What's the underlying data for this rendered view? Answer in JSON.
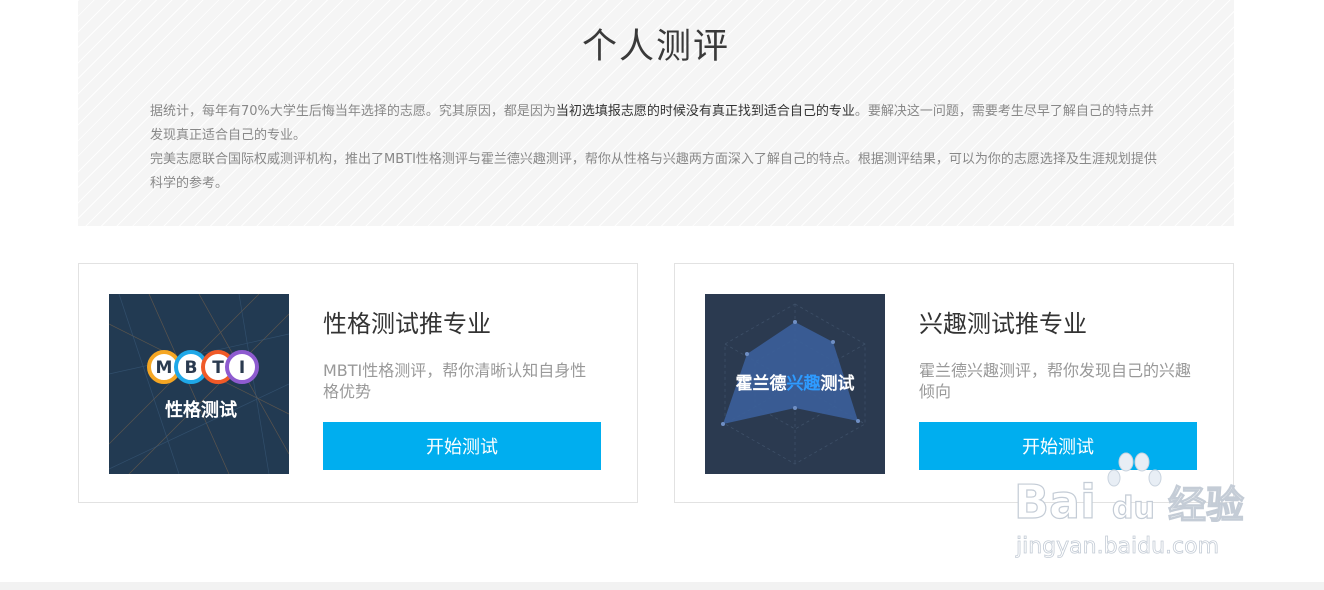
{
  "intro": {
    "title": "个人测评",
    "para1_pre": "据统计，每年有70%大学生后悔当年选择的志愿。究其原因，都是因为",
    "para1_highlight": "当初选填报志愿的时候没有真正找到适合自己的专业",
    "para1_post": "。要解决这一问题，需要考生尽早了解自己的特点并发现真正适合自己的专业。",
    "para2": "完美志愿联合国际权威测评机构，推出了MBTI性格测评与霍兰德兴趣测评，帮你从性格与兴趣两方面深入了解自己的特点。根据测评结果，可以为你的志愿选择及生涯规划提供科学的参考。"
  },
  "cards": [
    {
      "title": "性格测试推专业",
      "description": "MBTI性格测评，帮你清晰认知自身性格优势",
      "button_label": "开始测试",
      "image": {
        "letters": [
          "M",
          "B",
          "T",
          "I"
        ],
        "ring_colors": [
          "#f5a623",
          "#1fa8e8",
          "#f05a28",
          "#8e5bd0"
        ],
        "caption": "性格测试"
      }
    },
    {
      "title": "兴趣测试推专业",
      "description": "霍兰德兴趣测评，帮你发现自己的兴趣倾向",
      "button_label": "开始测试",
      "image": {
        "caption_part1": "霍兰德",
        "caption_part2": "兴趣",
        "caption_part3": "测试",
        "accent_color": "#2e9bff"
      }
    }
  ],
  "watermark": {
    "brand": "Bai",
    "brand2": "du",
    "product": "经验",
    "url": "jingyan.baidu.com"
  },
  "colors": {
    "button": "#00aeef",
    "mbti_bg": "#223a52",
    "holland_bg": "#2b3a50"
  }
}
